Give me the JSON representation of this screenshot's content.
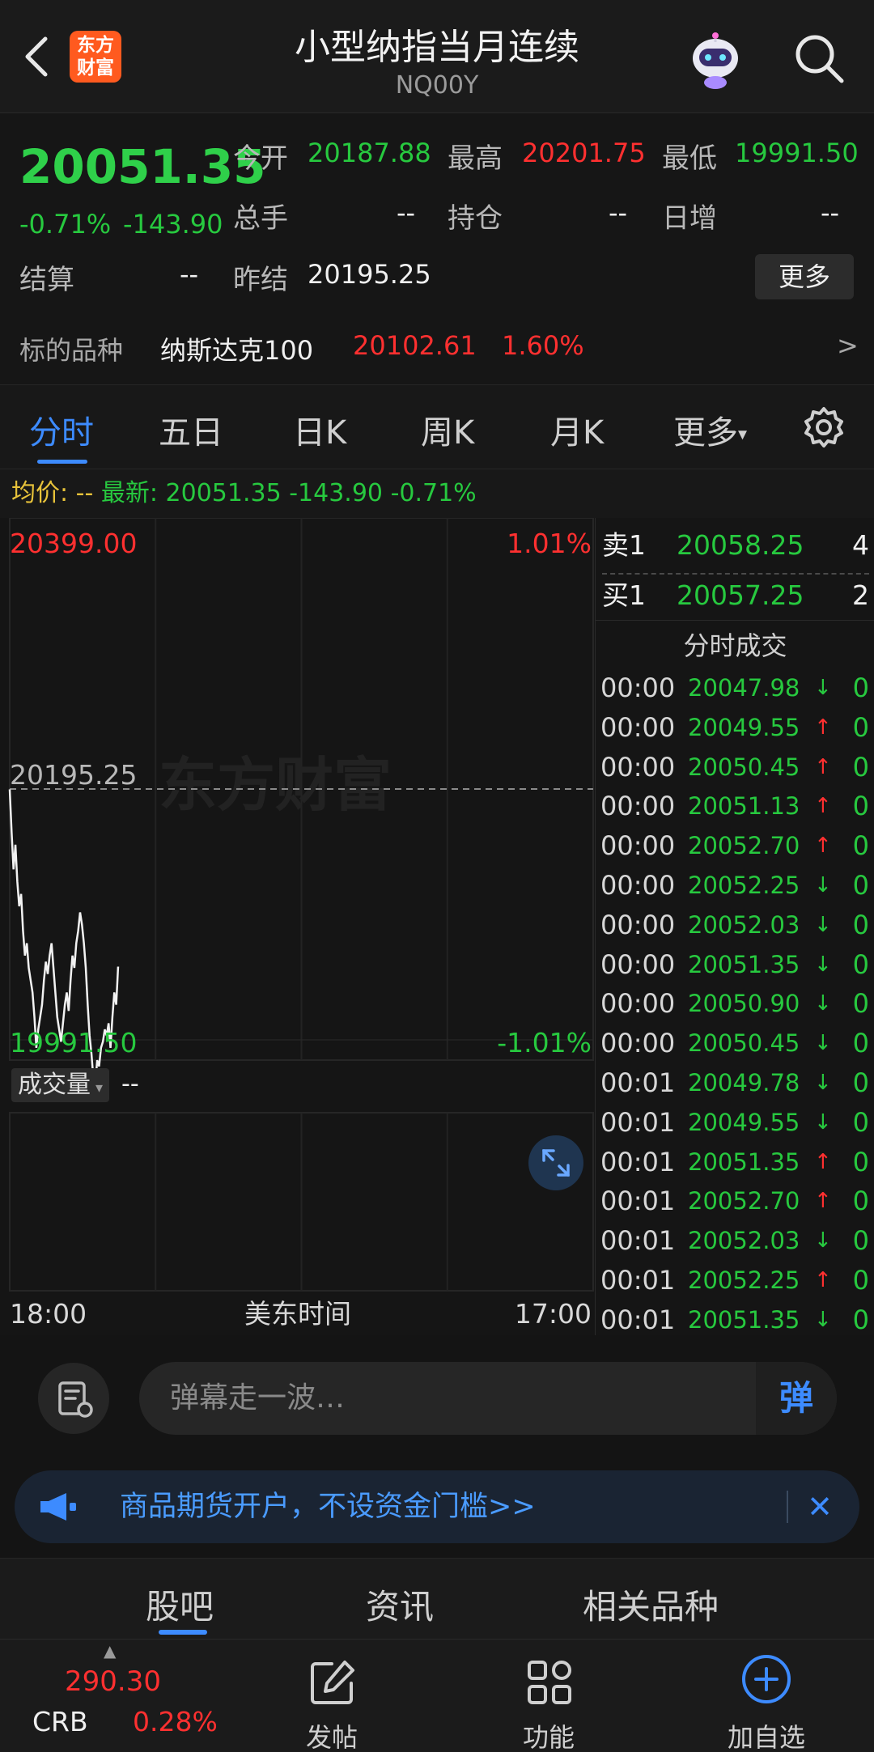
{
  "header": {
    "title": "小型纳指当月连续",
    "code": "NQ00Y",
    "logo_text_line1": "东方",
    "logo_text_line2": "财富"
  },
  "quote": {
    "last_price": "20051.35",
    "change_pct": "-0.71%",
    "change": "-143.90",
    "open_label": "今开",
    "open": "20187.88",
    "high_label": "最高",
    "high": "20201.75",
    "low_label": "最低",
    "low": "19991.50",
    "volume_label": "总手",
    "volume": "--",
    "oi_label": "持仓",
    "oi": "--",
    "daily_inc_label": "日增",
    "daily_inc": "--",
    "settle_label": "结算",
    "settle": "--",
    "prev_settle_label": "昨结",
    "prev_settle": "20195.25",
    "more_label": "更多",
    "underlying_label": "标的品种",
    "underlying_name": "纳斯达克100",
    "underlying_price": "20102.61",
    "underlying_pct": "1.60%",
    "chevron": ">"
  },
  "tabs": [
    {
      "label": "分时"
    },
    {
      "label": "五日"
    },
    {
      "label": "日K"
    },
    {
      "label": "周K"
    },
    {
      "label": "月K"
    },
    {
      "label": "更多"
    }
  ],
  "legend": {
    "avg_label": "均价:",
    "avg": "--",
    "latest_label": "最新:",
    "latest": "20051.35",
    "change": "-143.90",
    "pct": "-0.71%"
  },
  "chart_data": {
    "type": "line",
    "y_top_label": "20399.00",
    "y_mid_label": "20195.25",
    "y_bottom_label": "19991.50",
    "pct_top": "1.01%",
    "pct_bottom": "-1.01%",
    "ylim": [
      19991.5,
      20399.0
    ],
    "reference": 20195.25,
    "watermark": "东方财富",
    "x_start": "18:00",
    "x_mid": "美东时间",
    "x_end": "17:00",
    "volume_label": "成交量",
    "volume_value": "--",
    "series": [
      {
        "values": [
          20195,
          20160,
          20130,
          20150,
          20120,
          20100,
          20110,
          20080,
          20060,
          20070,
          20050,
          20040,
          20030,
          20010,
          19985,
          20000,
          20010,
          20020,
          20040,
          20055,
          20045,
          20060,
          20070,
          20050,
          20030,
          20010,
          20000,
          19990,
          20005,
          20020,
          20030,
          20015,
          20040,
          20060,
          20050,
          20070,
          20080,
          20095,
          20085,
          20070,
          20050,
          20020,
          19995,
          19980,
          19960,
          19955,
          19975,
          19970,
          19985,
          19990,
          20000,
          19995,
          20005,
          19985,
          20010,
          20030,
          20020,
          20051
        ]
      }
    ]
  },
  "orderbook": {
    "sell_label": "卖1",
    "sell_price": "20058.25",
    "sell_vol": "4",
    "buy_label": "买1",
    "buy_price": "20057.25",
    "buy_vol": "2",
    "trades_title": "分时成交",
    "trades": [
      {
        "time": "00:00",
        "price": "20047.98",
        "dir": "↓",
        "vol": "0"
      },
      {
        "time": "00:00",
        "price": "20049.55",
        "dir": "↑",
        "vol": "0"
      },
      {
        "time": "00:00",
        "price": "20050.45",
        "dir": "↑",
        "vol": "0"
      },
      {
        "time": "00:00",
        "price": "20051.13",
        "dir": "↑",
        "vol": "0"
      },
      {
        "time": "00:00",
        "price": "20052.70",
        "dir": "↑",
        "vol": "0"
      },
      {
        "time": "00:00",
        "price": "20052.25",
        "dir": "↓",
        "vol": "0"
      },
      {
        "time": "00:00",
        "price": "20052.03",
        "dir": "↓",
        "vol": "0"
      },
      {
        "time": "00:00",
        "price": "20051.35",
        "dir": "↓",
        "vol": "0"
      },
      {
        "time": "00:00",
        "price": "20050.90",
        "dir": "↓",
        "vol": "0"
      },
      {
        "time": "00:00",
        "price": "20050.45",
        "dir": "↓",
        "vol": "0"
      },
      {
        "time": "00:01",
        "price": "20049.78",
        "dir": "↓",
        "vol": "0"
      },
      {
        "time": "00:01",
        "price": "20049.55",
        "dir": "↓",
        "vol": "0"
      },
      {
        "time": "00:01",
        "price": "20051.35",
        "dir": "↑",
        "vol": "0"
      },
      {
        "time": "00:01",
        "price": "20052.70",
        "dir": "↑",
        "vol": "0"
      },
      {
        "time": "00:01",
        "price": "20052.03",
        "dir": "↓",
        "vol": "0"
      },
      {
        "time": "00:01",
        "price": "20052.25",
        "dir": "↑",
        "vol": "0"
      },
      {
        "time": "00:01",
        "price": "20051.35",
        "dir": "↓",
        "vol": "0"
      }
    ]
  },
  "danmu": {
    "placeholder": "弹幕走一波…",
    "send_label": "弹"
  },
  "banner": {
    "text": "商品期货开户，不设资金门槛>>",
    "close": "✕"
  },
  "subtabs": [
    {
      "label": "股吧"
    },
    {
      "label": "资讯"
    },
    {
      "label": "相关品种"
    }
  ],
  "bottom_bar": {
    "crb_value": "290.30",
    "crb_label": "CRB",
    "crb_pct": "0.28%",
    "post_label": "发帖",
    "func_label": "功能",
    "add_label": "加自选"
  },
  "colors": {
    "up": "#ff3030",
    "down": "#27c93f",
    "accent": "#3d8bff",
    "avg": "#e8c33a"
  }
}
